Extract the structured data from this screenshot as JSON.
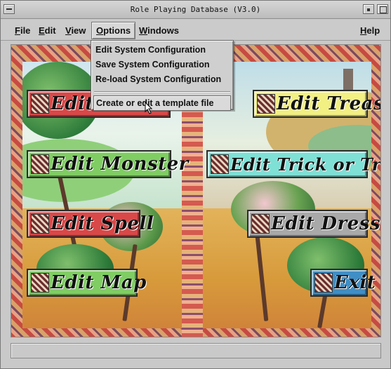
{
  "window": {
    "title": "Role Playing Database (V3.0)"
  },
  "menubar": {
    "file": {
      "label_u": "F",
      "label_rest": "ile"
    },
    "edit": {
      "label_u": "E",
      "label_rest": "dit"
    },
    "view": {
      "label_u": "V",
      "label_rest": "iew"
    },
    "options": {
      "label_u": "O",
      "label_rest": "ptions"
    },
    "windows": {
      "label_u": "W",
      "label_rest": "indows"
    },
    "help": {
      "label_u": "H",
      "label_rest": "elp"
    }
  },
  "options_menu": {
    "items": [
      "Edit System Configuration",
      "Save System Configuration",
      "Re-load System Configuration"
    ],
    "highlighted": "Create or edit a template file"
  },
  "buttons": {
    "edit_character": "Edit C",
    "edit_monster": "Edit Monster",
    "edit_spell": "Edit Spell",
    "edit_map": "Edit Map",
    "edit_treasure": "Edit Treasure",
    "edit_trick_or_trap": "Edit Trick or Trap",
    "edit_dressing": "Edit Dressing",
    "exit": "Exit"
  },
  "colors": {
    "red": "#d94848",
    "green": "#7fcd63",
    "yellow": "#f2ef83",
    "cyan": "#7fe0d6",
    "grey": "#a9a9a9",
    "blue": "#3f8fc6"
  }
}
